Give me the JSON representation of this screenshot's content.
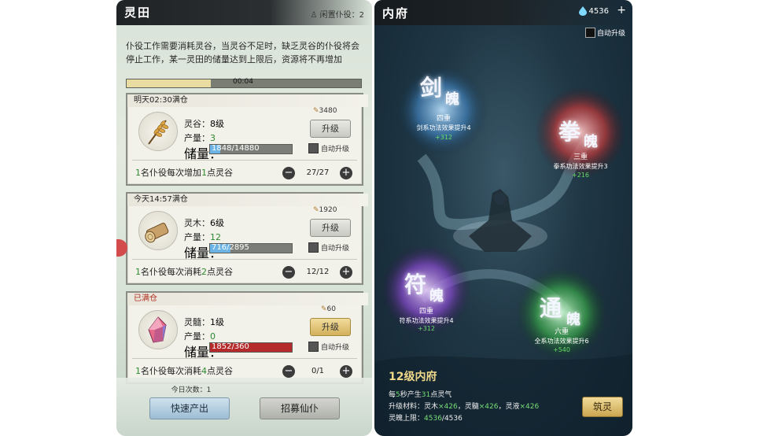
{
  "left": {
    "title": "灵田",
    "idle_workers": "闲置仆役：2",
    "description": "仆役工作需要消耗灵谷，当灵谷不足时，缺乏灵谷的仆役将会停止工作，某一灵田的储量达到上限后，资源将不再增加",
    "timer": "00:04",
    "timer_progress": 0.36,
    "cards": [
      {
        "header": "明天02:30满仓",
        "name_label": "灵谷：",
        "level": "8级",
        "output_label": "产量：",
        "output": "3",
        "storage_label": "储量：",
        "storage": "1848/14880",
        "storage_fraction": 0.124,
        "cost": "3480",
        "upgrade_label": "升级",
        "auto_label": "自动升级",
        "worker_pre": "1",
        "worker_mid": "名仆役每次增加",
        "worker_num": "1",
        "worker_post": "点灵谷",
        "count": "27/27"
      },
      {
        "header": "今天14:57满仓",
        "name_label": "灵木：",
        "level": "6级",
        "output_label": "产量：",
        "output": "12",
        "storage_label": "储量：",
        "storage": "716/2895",
        "storage_fraction": 0.247,
        "cost": "1920",
        "upgrade_label": "升级",
        "auto_label": "自动升级",
        "worker_pre": "1",
        "worker_mid": "名仆役每次消耗",
        "worker_num": "2",
        "worker_post": "点灵谷",
        "count": "12/12"
      },
      {
        "header": "已满仓",
        "name_label": "灵髓：",
        "level": "1级",
        "output_label": "产量：",
        "output": "0",
        "storage_label": "储量：",
        "storage": "1852/360",
        "storage_fraction": 1.0,
        "cost": "60",
        "upgrade_label": "升级",
        "auto_label": "自动升级",
        "worker_pre": "1",
        "worker_mid": "名仆役每次消耗",
        "worker_num": "4",
        "worker_post": "点灵谷",
        "count": "0/1"
      }
    ],
    "today_count": "今日次数：1",
    "quick_output": "快速产出",
    "recruit": "招募仙仆"
  },
  "right": {
    "title": "内府",
    "resource": "4536",
    "plus": "+",
    "auto_upgrade": "自动升级",
    "orbs": [
      {
        "char1": "剑",
        "char2": "魄",
        "tier": "四重",
        "desc": "剑系功法效果提升4",
        "val": "+312",
        "color": "#5aa8e0"
      },
      {
        "char1": "拳",
        "char2": "魄",
        "tier": "三重",
        "desc": "拳系功法效果提升3",
        "val": "+216",
        "color": "#e05a5a"
      },
      {
        "char1": "符",
        "char2": "魄",
        "tier": "四重",
        "desc": "符系功法效果提升4",
        "val": "+312",
        "color": "#a06ae0"
      },
      {
        "char1": "通",
        "char2": "魄",
        "tier": "六重",
        "desc": "全系功法效果提升6",
        "val": "+540",
        "color": "#5ed070"
      }
    ],
    "level_title": "12级内府",
    "line1_a": "每",
    "line1_b": "5",
    "line1_c": "秒产生",
    "line1_d": "31",
    "line1_e": "点灵气",
    "line2_label": "升级材料：灵木",
    "line2_v1": "×426",
    "line2_m2": "，灵髓",
    "line2_v2": "×426",
    "line2_m3": "，灵液",
    "line2_v3": "×426",
    "line3_label": "灵魄上限：",
    "line3_val": "4536",
    "line3_max": "/4536",
    "build": "筑灵"
  }
}
